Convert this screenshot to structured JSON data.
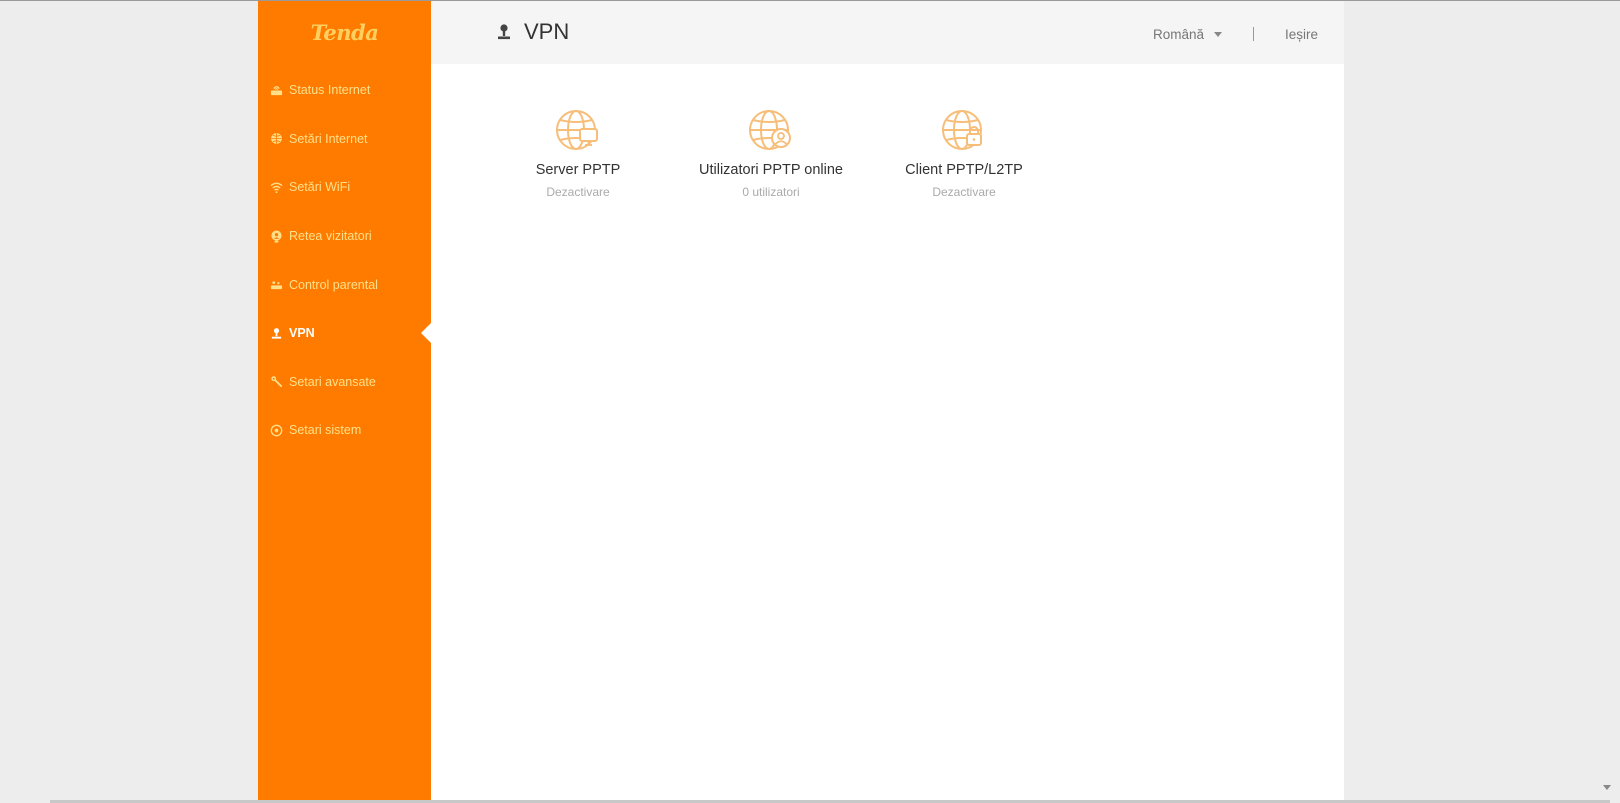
{
  "brand": {
    "logo_text": "Tenda",
    "accent": "#ff7b00"
  },
  "sidebar": {
    "items": [
      {
        "label": "Status Internet",
        "icon": "router-icon",
        "active": false
      },
      {
        "label": "Setări Internet",
        "icon": "globe-icon",
        "active": false
      },
      {
        "label": "Setări WiFi",
        "icon": "wifi-icon",
        "active": false
      },
      {
        "label": "Retea vizitatori",
        "icon": "guest-icon",
        "active": false
      },
      {
        "label": "Control parental",
        "icon": "parental-icon",
        "active": false
      },
      {
        "label": "VPN",
        "icon": "vpn-icon",
        "active": true
      },
      {
        "label": "Setari avansate",
        "icon": "wrench-icon",
        "active": false
      },
      {
        "label": "Setari sistem",
        "icon": "gear-icon",
        "active": false
      }
    ]
  },
  "header": {
    "title": "VPN",
    "language": "Română",
    "logout": "Ieșire"
  },
  "cards": [
    {
      "title": "Server PPTP",
      "status": "Dezactivare",
      "icon": "server-globe-icon"
    },
    {
      "title": "Utilizatori PPTP online",
      "status": "0 utilizatori",
      "icon": "users-globe-icon"
    },
    {
      "title": "Client PPTP/L2TP",
      "status": "Dezactivare",
      "icon": "lock-globe-icon"
    }
  ]
}
